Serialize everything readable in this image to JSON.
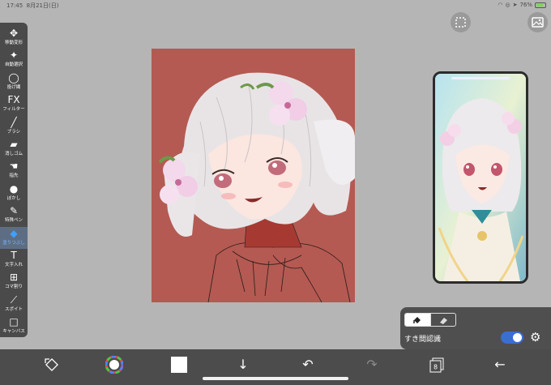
{
  "status": {
    "time": "17:45",
    "date": "8月21日(日)",
    "battery": "76%"
  },
  "toolbar": {
    "items": [
      {
        "label": "移動変形",
        "icon": "move-arrows-icon",
        "glyph": "✥"
      },
      {
        "label": "自動選択",
        "icon": "magic-wand-icon",
        "glyph": "✦"
      },
      {
        "label": "投げ縄",
        "icon": "lasso-icon",
        "glyph": "◯"
      },
      {
        "label": "フィルター",
        "icon": "fx-icon",
        "glyph": "FX"
      },
      {
        "label": "ブラシ",
        "icon": "brush-icon",
        "glyph": "╱"
      },
      {
        "label": "消しゴム",
        "icon": "eraser-icon",
        "glyph": "▰"
      },
      {
        "label": "指先",
        "icon": "finger-icon",
        "glyph": "☚"
      },
      {
        "label": "ぼかし",
        "icon": "blur-drop-icon",
        "glyph": "●"
      },
      {
        "label": "特殊ペン",
        "icon": "special-pen-icon",
        "glyph": "✎"
      },
      {
        "label": "塗りつぶし",
        "icon": "fill-bucket-icon",
        "glyph": "◆",
        "active": true
      },
      {
        "label": "文字入れ",
        "icon": "text-icon",
        "glyph": "T"
      },
      {
        "label": "コマ割り",
        "icon": "frame-divide-icon",
        "glyph": "⊞"
      },
      {
        "label": "スポイト",
        "icon": "eyedropper-icon",
        "glyph": "⟋"
      },
      {
        "label": "キャンバス",
        "icon": "canvas-icon",
        "glyph": "□"
      }
    ]
  },
  "panel": {
    "fill_mode_icon": "fill-bucket-icon",
    "erase_mode_icon": "eraser-icon",
    "gap_label": "すき間認識",
    "gap_toggle_on": true
  },
  "bottom": {
    "layer_count": "8",
    "current_color": "#ffffff"
  },
  "colors": {
    "canvas_bg": "#b45a52",
    "toolbar_bg": "#4a4a4a",
    "accent": "#3b6ed1"
  }
}
